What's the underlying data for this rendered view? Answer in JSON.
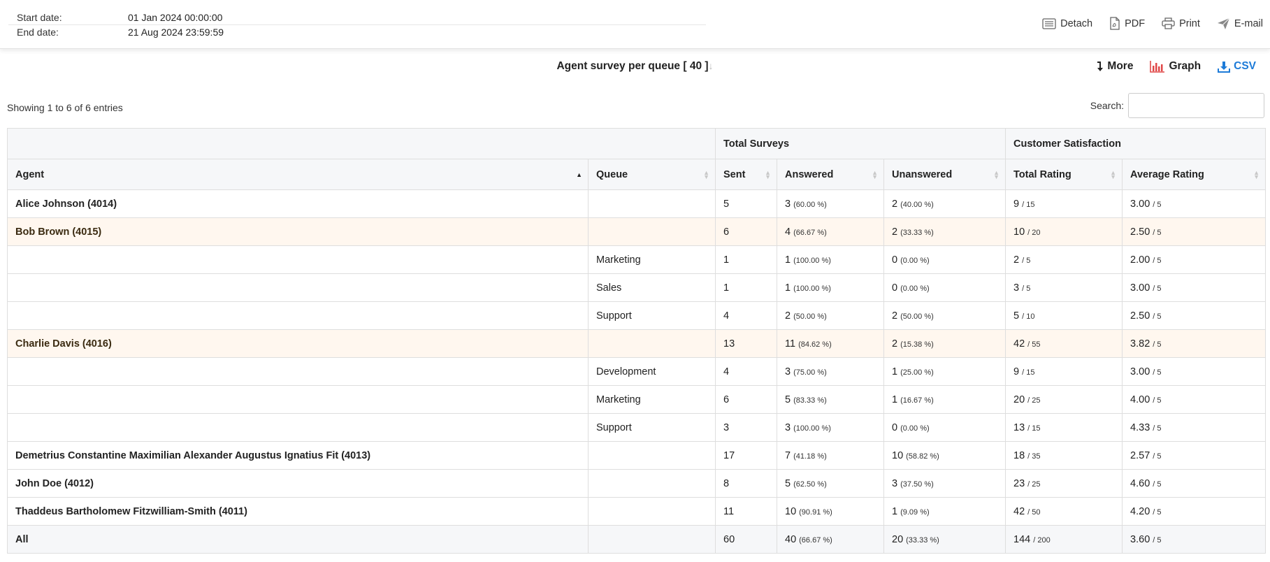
{
  "dates": {
    "start_label": "Start date:",
    "start_value": "01 Jan 2024 00:00:00",
    "end_label": "End date:",
    "end_value": "21 Aug 2024 23:59:59"
  },
  "actions": {
    "detach": "Detach",
    "pdf": "PDF",
    "print": "Print",
    "email": "E-mail"
  },
  "report": {
    "title": "Agent survey per queue [ 40 ]",
    "title_arrow": "↓"
  },
  "tools": {
    "more": "More",
    "graph": "Graph",
    "csv": "CSV"
  },
  "table_info": "Showing 1 to 6 of 6 entries",
  "search": {
    "label": "Search:",
    "value": ""
  },
  "headers": {
    "group_total": "Total Surveys",
    "group_satisfaction": "Customer Satisfaction",
    "agent": "Agent",
    "queue": "Queue",
    "sent": "Sent",
    "answered": "Answered",
    "unanswered": "Unanswered",
    "total_rating": "Total Rating",
    "average_rating": "Average Rating"
  },
  "rows": [
    {
      "agent": "Alice Johnson (4014)",
      "queue": "",
      "sent": "5",
      "ans": "3",
      "ans_pct": "(60.00 %)",
      "unans": "2",
      "unans_pct": "(40.00 %)",
      "tr": "9",
      "tr_den": "/ 15",
      "avg": "3.00",
      "avg_den": "/ 5"
    },
    {
      "agent": "Bob Brown (4015)",
      "queue": "",
      "sent": "6",
      "ans": "4",
      "ans_pct": "(66.67 %)",
      "unans": "2",
      "unans_pct": "(33.33 %)",
      "tr": "10",
      "tr_den": "/ 20",
      "avg": "2.50",
      "avg_den": "/ 5"
    },
    {
      "agent": "",
      "queue": "Marketing",
      "sent": "1",
      "ans": "1",
      "ans_pct": "(100.00 %)",
      "unans": "0",
      "unans_pct": "(0.00 %)",
      "tr": "2",
      "tr_den": "/ 5",
      "avg": "2.00",
      "avg_den": "/ 5"
    },
    {
      "agent": "",
      "queue": "Sales",
      "sent": "1",
      "ans": "1",
      "ans_pct": "(100.00 %)",
      "unans": "0",
      "unans_pct": "(0.00 %)",
      "tr": "3",
      "tr_den": "/ 5",
      "avg": "3.00",
      "avg_den": "/ 5"
    },
    {
      "agent": "",
      "queue": "Support",
      "sent": "4",
      "ans": "2",
      "ans_pct": "(50.00 %)",
      "unans": "2",
      "unans_pct": "(50.00 %)",
      "tr": "5",
      "tr_den": "/ 10",
      "avg": "2.50",
      "avg_den": "/ 5"
    },
    {
      "agent": "Charlie Davis (4016)",
      "queue": "",
      "sent": "13",
      "ans": "11",
      "ans_pct": "(84.62 %)",
      "unans": "2",
      "unans_pct": "(15.38 %)",
      "tr": "42",
      "tr_den": "/ 55",
      "avg": "3.82",
      "avg_den": "/ 5"
    },
    {
      "agent": "",
      "queue": "Development",
      "sent": "4",
      "ans": "3",
      "ans_pct": "(75.00 %)",
      "unans": "1",
      "unans_pct": "(25.00 %)",
      "tr": "9",
      "tr_den": "/ 15",
      "avg": "3.00",
      "avg_den": "/ 5"
    },
    {
      "agent": "",
      "queue": "Marketing",
      "sent": "6",
      "ans": "5",
      "ans_pct": "(83.33 %)",
      "unans": "1",
      "unans_pct": "(16.67 %)",
      "tr": "20",
      "tr_den": "/ 25",
      "avg": "4.00",
      "avg_den": "/ 5"
    },
    {
      "agent": "",
      "queue": "Support",
      "sent": "3",
      "ans": "3",
      "ans_pct": "(100.00 %)",
      "unans": "0",
      "unans_pct": "(0.00 %)",
      "tr": "13",
      "tr_den": "/ 15",
      "avg": "4.33",
      "avg_den": "/ 5"
    },
    {
      "agent": "Demetrius Constantine Maximilian Alexander Augustus Ignatius Fit (4013)",
      "queue": "",
      "sent": "17",
      "ans": "7",
      "ans_pct": "(41.18 %)",
      "unans": "10",
      "unans_pct": "(58.82 %)",
      "tr": "18",
      "tr_den": "/ 35",
      "avg": "2.57",
      "avg_den": "/ 5"
    },
    {
      "agent": "John Doe (4012)",
      "queue": "",
      "sent": "8",
      "ans": "5",
      "ans_pct": "(62.50 %)",
      "unans": "3",
      "unans_pct": "(37.50 %)",
      "tr": "23",
      "tr_den": "/ 25",
      "avg": "4.60",
      "avg_den": "/ 5"
    },
    {
      "agent": "Thaddeus Bartholomew Fitzwilliam-Smith (4011)",
      "queue": "",
      "sent": "11",
      "ans": "10",
      "ans_pct": "(90.91 %)",
      "unans": "1",
      "unans_pct": "(9.09 %)",
      "tr": "42",
      "tr_den": "/ 50",
      "avg": "4.20",
      "avg_den": "/ 5"
    }
  ],
  "total": {
    "agent": "All",
    "queue": "",
    "sent": "60",
    "ans": "40",
    "ans_pct": "(66.67 %)",
    "unans": "20",
    "unans_pct": "(33.33 %)",
    "tr": "144",
    "tr_den": "/ 200",
    "avg": "3.60",
    "avg_den": "/ 5"
  }
}
